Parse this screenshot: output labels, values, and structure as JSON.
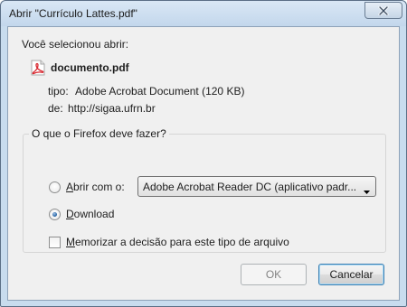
{
  "window": {
    "title": "Abrir \"Currículo Lattes.pdf\"",
    "close_icon": "close-icon"
  },
  "dialog": {
    "intro": "Você selecionou abrir:",
    "file": {
      "icon": "pdf-file-icon",
      "name": "documento.pdf",
      "type_label": "tipo:",
      "type_value": "Adobe Acrobat Document (120 KB)",
      "from_label": "de:",
      "from_value": "http://sigaa.ufrn.br"
    },
    "question": "O que o Firefox deve fazer?",
    "open_with": {
      "label_first": "A",
      "label_rest": "brir com o:",
      "selected": false,
      "app": "Adobe Acrobat Reader DC  (aplicativo padr..."
    },
    "download": {
      "label_first": "D",
      "label_rest": "ownload",
      "selected": true
    },
    "remember": {
      "label_first": "M",
      "label_rest": "emorizar a decisão para este tipo de arquivo",
      "checked": false
    },
    "buttons": {
      "ok": "OK",
      "cancel": "Cancelar"
    }
  },
  "colors": {
    "frame": "#c8dcee",
    "client": "#f0f0f0",
    "radio_dot": "#1f5e9f"
  }
}
